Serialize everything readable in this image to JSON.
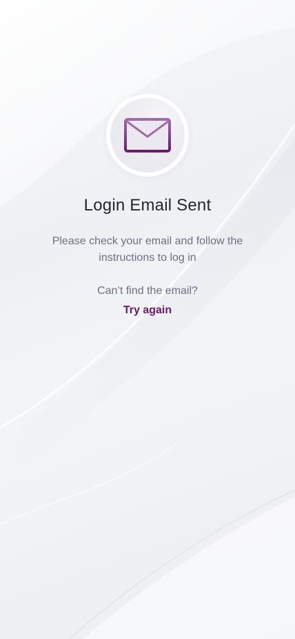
{
  "header": {
    "title": "Login Email Sent"
  },
  "body": {
    "message": "Please check your email and follow the instructions to log in",
    "prompt": "Can’t find the email?",
    "retry_label": "Try again"
  },
  "icons": {
    "main": "envelope-icon"
  },
  "colors": {
    "accent": "#6b1a6e",
    "title": "#23262d",
    "text_muted": "#6c7180",
    "background": "#f2f3f6"
  }
}
